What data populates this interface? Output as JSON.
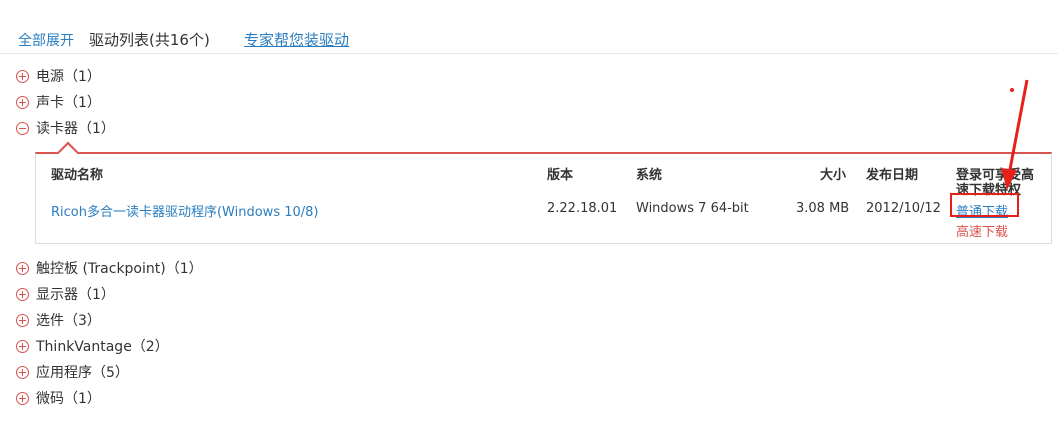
{
  "header": {
    "expand_all": "全部展开",
    "list_title": "驱动列表(共16个)",
    "expert_install": "专家帮您装驱动"
  },
  "categories": [
    {
      "label": "电源（1）",
      "expanded": false
    },
    {
      "label": "声卡（1）",
      "expanded": false
    },
    {
      "label": "读卡器（1）",
      "expanded": true
    },
    {
      "label": "触控板 (Trackpoint)（1）",
      "expanded": false
    },
    {
      "label": "显示器（1）",
      "expanded": false
    },
    {
      "label": "选件（3）",
      "expanded": false
    },
    {
      "label": "ThinkVantage（2）",
      "expanded": false
    },
    {
      "label": "应用程序（5）",
      "expanded": false
    },
    {
      "label": "微码（1）",
      "expanded": false
    }
  ],
  "table": {
    "headers": {
      "name": "驱动名称",
      "version": "版本",
      "system": "系统",
      "size": "大小",
      "date": "发布日期",
      "login_line1": "登录可享受高",
      "login_line2": "速下载特权"
    },
    "row": {
      "name": "Ricoh多合一读卡器驱动程序(Windows 10/8)",
      "version": "2.22.18.01",
      "system": "Windows 7 64-bit",
      "size": "3.08 MB",
      "date": "2012/10/12",
      "normal_download": "普通下载",
      "fast_download": "高速下载"
    }
  },
  "colors": {
    "link": "#2a7dc0",
    "accent_red": "#d9534f",
    "annotation_red": "#e8201a"
  }
}
